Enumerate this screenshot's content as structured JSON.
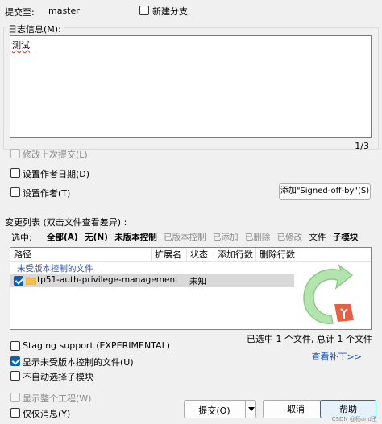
{
  "header": {
    "commit_to_label": "提交至:",
    "branch": "master",
    "new_branch_label": "新建分支"
  },
  "log_message": {
    "group_label": "日志信息(M):",
    "text": "测试",
    "position": "1/3"
  },
  "options": {
    "amend_label": "修改上次提交(L)",
    "set_author_date_label": "设置作者日期(D)",
    "set_author_label": "设置作者(T)",
    "signoff_button": "添加\"Signed-off-by\"(S)"
  },
  "changes": {
    "section_label": "变更列表 (双击文件查看差异) :",
    "select_label": "选中:",
    "filters": [
      {
        "label": "全部(A)",
        "bold": true,
        "enabled": true
      },
      {
        "label": "无(N)",
        "bold": true,
        "enabled": true
      },
      {
        "label": "未版本控制",
        "bold": true,
        "enabled": true
      },
      {
        "label": "已版本控制",
        "bold": false,
        "enabled": false
      },
      {
        "label": "已添加",
        "bold": false,
        "enabled": false
      },
      {
        "label": "已删除",
        "bold": false,
        "enabled": false
      },
      {
        "label": "已修改",
        "bold": false,
        "enabled": false
      },
      {
        "label": "文件",
        "bold": false,
        "enabled": true
      },
      {
        "label": "子模块",
        "bold": true,
        "enabled": true
      }
    ],
    "columns": [
      "路径",
      "扩展名",
      "状态",
      "添加行数",
      "删除行数"
    ],
    "group_header": "未受版本控制的文件",
    "rows": [
      {
        "path": "tp51-auth-privilege-management",
        "ext": "",
        "status": "未知",
        "added": "",
        "deleted": "",
        "checked": true
      }
    ],
    "summary": "已选中 1 个文件, 总计 1 个文件",
    "view_patch_link": "查看补丁>>"
  },
  "bottom_options": {
    "staging_support": "Staging support (EXPERIMENTAL)",
    "show_unversioned": "显示未受版本控制的文件(U)",
    "no_auto_submodule": "不自动选择子模块",
    "show_whole_project": "显示整个工程(W)",
    "message_only": "仅仅消息(Y)"
  },
  "buttons": {
    "commit": "提交(O)",
    "cancel": "取消",
    "help": "帮助"
  },
  "watermark": "CSDN @杨and王",
  "colors": {
    "accent": "#0a5fb8",
    "link": "#1a56c4",
    "group_header": "#3050a8",
    "selected_row": "#d9d9d9",
    "help_button_bg": "#e5f1fb",
    "help_button_border": "#0078d7"
  }
}
